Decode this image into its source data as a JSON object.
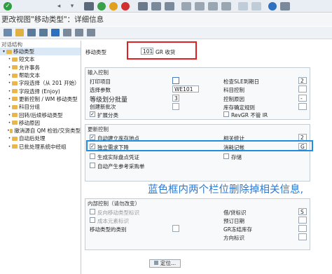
{
  "window_title": "更改视图\"移动类型\"：详细信息",
  "tree": {
    "header": "对话结构",
    "items": [
      {
        "label": "移动类型",
        "expanded": true,
        "selected": true,
        "level": 0
      },
      {
        "label": "短文本",
        "level": 1
      },
      {
        "label": "允许事务",
        "level": 1
      },
      {
        "label": "帮助文本",
        "level": 1
      },
      {
        "label": "字段选择（从 201 开始）",
        "level": 1
      },
      {
        "label": "字段选择 (Enjoy)",
        "level": 1
      },
      {
        "label": "更新控制 / WM 移动类型",
        "level": 1
      },
      {
        "label": "科目分组",
        "level": 1
      },
      {
        "label": "回转/后续移动类型",
        "level": 1
      },
      {
        "label": "移动原因",
        "level": 1
      },
      {
        "label": "撤消源自 QM 检验/交货类型",
        "level": 1
      },
      {
        "label": "自动后处理",
        "level": 1
      },
      {
        "label": "已批处理系统中经组",
        "level": 1
      }
    ]
  },
  "movement_type": {
    "label": "移动类型",
    "code": "101",
    "text": "GR 收货"
  },
  "input_control": {
    "title": "输入控制",
    "print_item_label": "打印项目",
    "print_item_value": "",
    "check_sled_label": "检查SLE到期日",
    "check_sled_value": "2",
    "selection_param_label": "选择参数",
    "selection_param_value": "WE101",
    "account_control_label": "科目控制",
    "account_control_value": "",
    "level_batch_label": "等级划分批量",
    "level_batch_value": "3",
    "control_reason_label": "控制原因",
    "control_reason_value": "-",
    "create_batch_label": "创建新批次",
    "stock_type_label": "库存确定规则",
    "stock_type_value": "",
    "ext_class_label": "扩展分类",
    "revgr_label": "RevGR 不管 IR"
  },
  "update_control": {
    "title": "更新控制",
    "auto_storage_label": "自动建立库存地点",
    "rel_stats_label": "相关统计",
    "rel_stats_value": "2",
    "indep_req_label": "独立需求下降",
    "consume_label": "消耗记帐",
    "consume_value": "G",
    "gen_phys_label": "生成实际盘点凭证",
    "store_label": "存储",
    "auto_create_label": "自动产生参考采购单"
  },
  "internal_control": {
    "title": "内部控制（请勿改变）",
    "rev_move_label": "反向移动类型标识",
    "credit_debit_label": "借/贷标识",
    "credit_debit_value": "S",
    "cost_element_label": "成本元素标识",
    "plan_date_label": "预订日期",
    "plan_date_value": "",
    "move_type_cat_label": "移动类型的类别",
    "grn_label": "GR冻结库存",
    "grn_value": "",
    "direction_label": "方向标识",
    "direction_value": ""
  },
  "position_button": "定位...",
  "annotation": "蓝色框内两个栏位删除掉相关信息,",
  "colors": {
    "red": "#e02020",
    "blue": "#1e8fe0",
    "annot": "#2979d8"
  }
}
